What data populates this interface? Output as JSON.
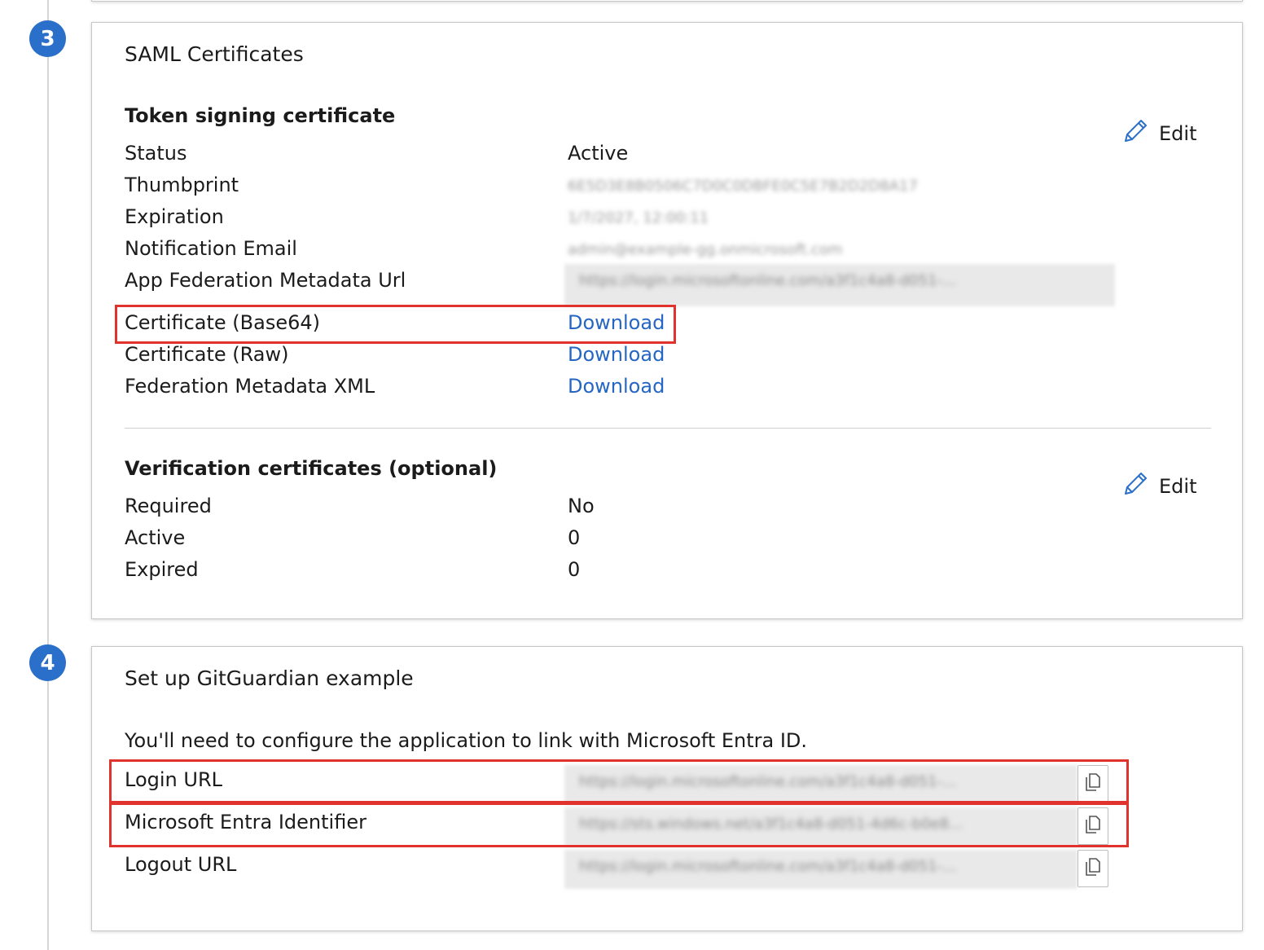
{
  "steps": {
    "step3": "3",
    "step4": "4"
  },
  "saml": {
    "title": "SAML Certificates",
    "token": {
      "heading": "Token signing certificate",
      "edit": "Edit",
      "rows": [
        {
          "label": "Status",
          "value": "Active"
        },
        {
          "label": "Thumbprint",
          "value": "6E5D3E8B0506C7D0C0DBFE0C5E7B2D2D8A17"
        },
        {
          "label": "Expiration",
          "value": "1/7/2027, 12:00:11"
        },
        {
          "label": "Notification Email",
          "value": "admin@example-gg.onmicrosoft.com"
        },
        {
          "label": "App Federation Metadata Url",
          "value": "https://login.microsoftonline.com/a3f1c4a8-d051-..."
        },
        {
          "label": "Certificate (Base64)",
          "value": "Download"
        },
        {
          "label": "Certificate (Raw)",
          "value": "Download"
        },
        {
          "label": "Federation Metadata XML",
          "value": "Download"
        }
      ]
    },
    "verification": {
      "heading": "Verification certificates (optional)",
      "edit": "Edit",
      "rows": [
        {
          "label": "Required",
          "value": "No"
        },
        {
          "label": "Active",
          "value": "0"
        },
        {
          "label": "Expired",
          "value": "0"
        }
      ]
    }
  },
  "setup": {
    "title": "Set up GitGuardian example",
    "description": "You'll need to configure the application to link with Microsoft Entra ID.",
    "rows": [
      {
        "label": "Login URL",
        "value": "https://login.microsoftonline.com/a3f1c4a8-d051-..."
      },
      {
        "label": "Microsoft Entra Identifier",
        "value": "https://sts.windows.net/a3f1c4a8-d051-4d6c-b0e8..."
      },
      {
        "label": "Logout URL",
        "value": "https://login.microsoftonline.com/a3f1c4a8-d051-..."
      }
    ]
  },
  "colors": {
    "accent": "#2a6fc9",
    "link": "#2566c4",
    "highlight": "#e0332d"
  }
}
